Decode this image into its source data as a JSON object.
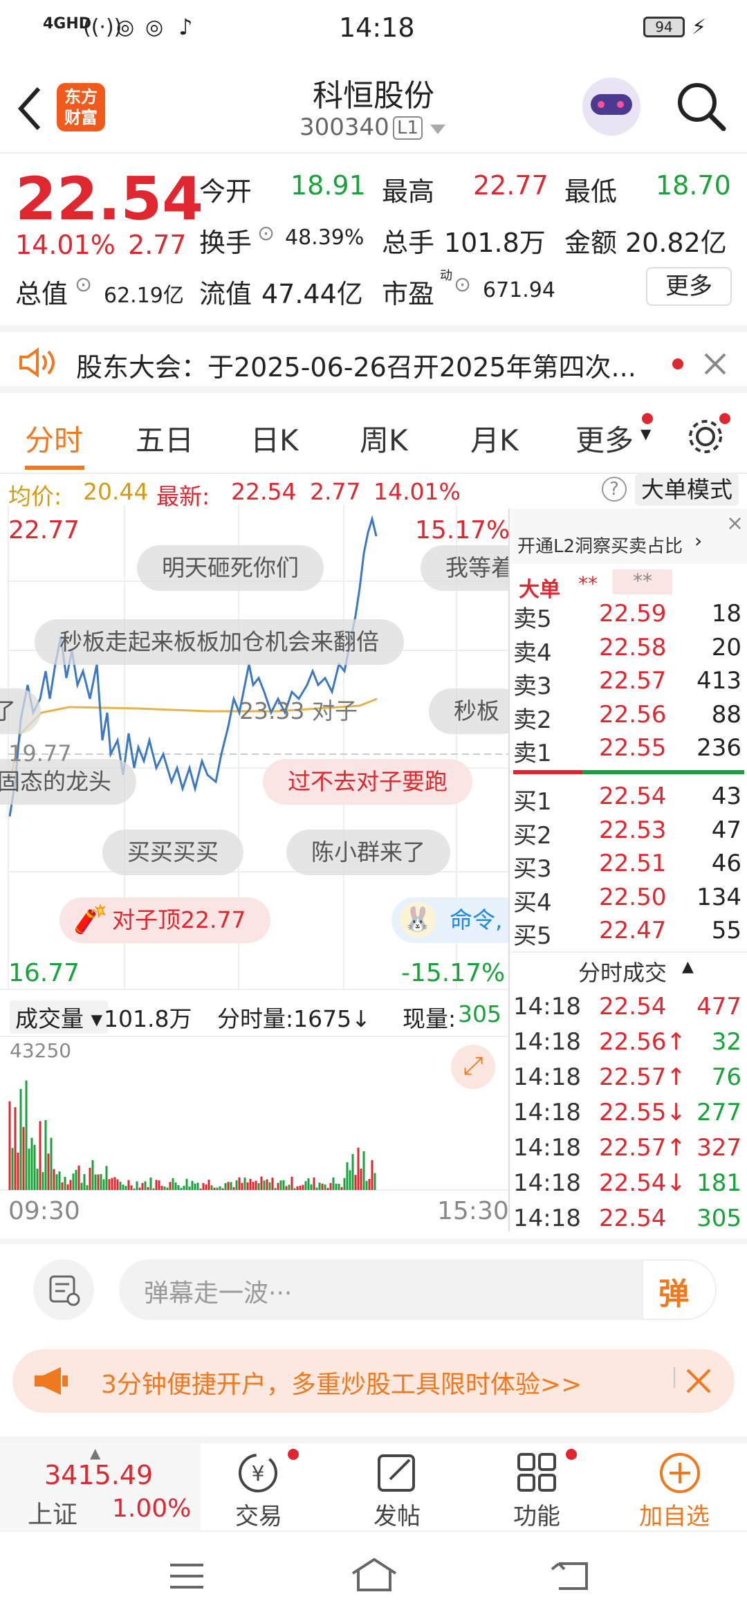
{
  "status": {
    "net": "4GHD",
    "time": "14:18",
    "battery": "94"
  },
  "header": {
    "title": "科恒股份",
    "code": "300340",
    "level": "L1",
    "logo": "东方\n财富"
  },
  "quote": {
    "price": "22.54",
    "pct": "14.01%",
    "chg": "2.77",
    "labels": {
      "open": "今开",
      "high": "最高",
      "low": "最低",
      "turnover": "换手",
      "vol": "总手",
      "amount": "金额",
      "mcap": "总值",
      "float": "流值",
      "pe": "市盈",
      "pe_sup": "动"
    },
    "open": "18.91",
    "high": "22.77",
    "low": "18.70",
    "turnover": "48.39%",
    "vol": "101.8万",
    "amount": "20.82亿",
    "mcap": "62.19亿",
    "float": "47.44亿",
    "pe": "671.94",
    "more": "更多"
  },
  "notice": {
    "text": "股东大会：于2025-06-26召开2025年第四次..."
  },
  "tabs": [
    "分时",
    "五日",
    "日K",
    "周K",
    "月K",
    "更多"
  ],
  "avgbar": {
    "avg_label": "均价:",
    "avg": "20.44",
    "latest_label": "最新:",
    "latest": "22.54",
    "chg": "2.77",
    "pct": "14.01%",
    "mode": "大单模式"
  },
  "chart": {
    "ymax": "22.77",
    "ymin": "16.77",
    "pmax": "15.17%",
    "pmin": "-15.17%",
    "mid": "19.77",
    "t_start": "09:30",
    "t_end": "15:30",
    "vol_max": "43250",
    "barrage": [
      "明天砸死你们",
      "我等着",
      "秒板走起来板板加仓机会来翻倍",
      "23.33 对子",
      "秒板",
      "过不去对子要跑",
      "固态的龙头",
      "买买买买",
      "陈小群来了",
      "对子顶22.77",
      "命令,",
      "了"
    ],
    "vol_label": "成交量",
    "vol_total": "101.8万",
    "fen_label": "分时量:1675↓",
    "now_label": "现量:",
    "now": "305"
  },
  "book": {
    "banner": "开通L2洞察买卖占比",
    "big": "大单",
    "stars": "**",
    "sells": [
      [
        "卖5",
        "22.59",
        "18"
      ],
      [
        "卖4",
        "22.58",
        "20"
      ],
      [
        "卖3",
        "22.57",
        "413"
      ],
      [
        "卖2",
        "22.56",
        "88"
      ],
      [
        "卖1",
        "22.55",
        "236"
      ]
    ],
    "buys": [
      [
        "买1",
        "22.54",
        "43"
      ],
      [
        "买2",
        "22.53",
        "47"
      ],
      [
        "买3",
        "22.51",
        "46"
      ],
      [
        "买4",
        "22.50",
        "134"
      ],
      [
        "买5",
        "22.47",
        "55"
      ]
    ],
    "ticks_title": "分时成交",
    "ticks": [
      [
        "14:18",
        "22.54",
        "477",
        ""
      ],
      [
        "14:18",
        "22.56↑",
        "32",
        "g"
      ],
      [
        "14:18",
        "22.57↑",
        "76",
        "g"
      ],
      [
        "14:18",
        "22.55↓",
        "277",
        "g"
      ],
      [
        "14:18",
        "22.57↑",
        "327",
        "r"
      ],
      [
        "14:18",
        "22.54↓",
        "181",
        "g"
      ],
      [
        "14:18",
        "22.54",
        "305",
        "g"
      ]
    ]
  },
  "danmu": {
    "placeholder": "弹幕走一波···",
    "send": "弹"
  },
  "promo": {
    "text": "3分钟便捷开户，多重炒股工具限时体验>>"
  },
  "nav": {
    "index_value": "3415.49",
    "index_name": "上证",
    "index_pct": "1.00%",
    "items": [
      "交易",
      "发帖",
      "功能",
      "加自选"
    ]
  }
}
